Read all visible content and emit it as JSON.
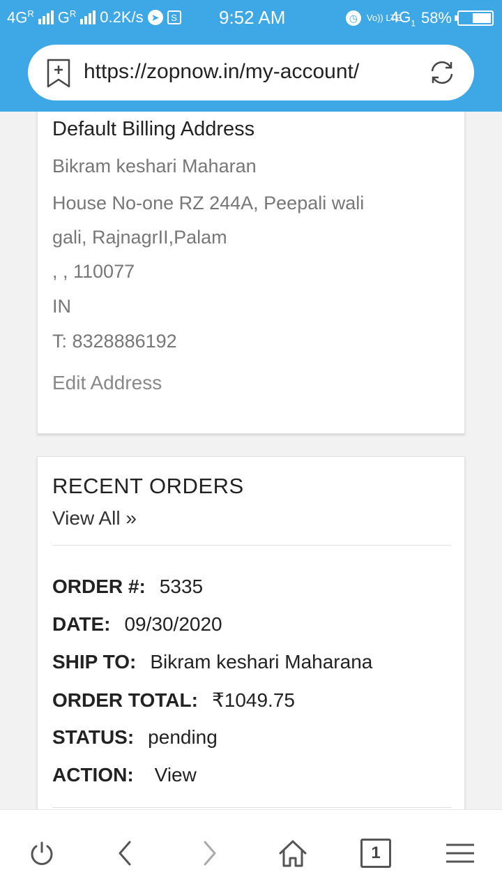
{
  "status_bar": {
    "net1": "4G",
    "net2": "G",
    "roaming": "R",
    "speed": "0.2K/s",
    "time": "9:52 AM",
    "volte": "Vo)) LTE",
    "net3": "4G",
    "sim": "1",
    "battery": "58%",
    "battery_level": 0.58
  },
  "url_bar": {
    "url": "https://zopnow.in/my-account/"
  },
  "billing": {
    "heading": "Default Billing Address",
    "name": "Bikram keshari Maharan",
    "line1": "House No-one RZ 244A, Peepali wali",
    "line2": "gali, RajnagrII,Palam",
    "line3": ", , 110077",
    "country": "IN",
    "phone": "T: 8328886192",
    "edit_label": "Edit Address"
  },
  "recent_orders": {
    "heading": "RECENT ORDERS",
    "view_all": "View All »",
    "order_label": "ORDER #:",
    "order_value": "5335",
    "date_label": "DATE:",
    "date_value": "09/30/2020",
    "ship_label": "SHIP TO:",
    "ship_value": "Bikram keshari Maharana",
    "total_label": "ORDER TOTAL:",
    "total_value": "₹1049.75",
    "status_label": "STATUS:",
    "status_value": "pending",
    "action_label": "ACTION:",
    "action_value": "View"
  },
  "bottom_nav": {
    "tab_count": "1"
  },
  "colors": {
    "accent": "#3ea8e6"
  }
}
